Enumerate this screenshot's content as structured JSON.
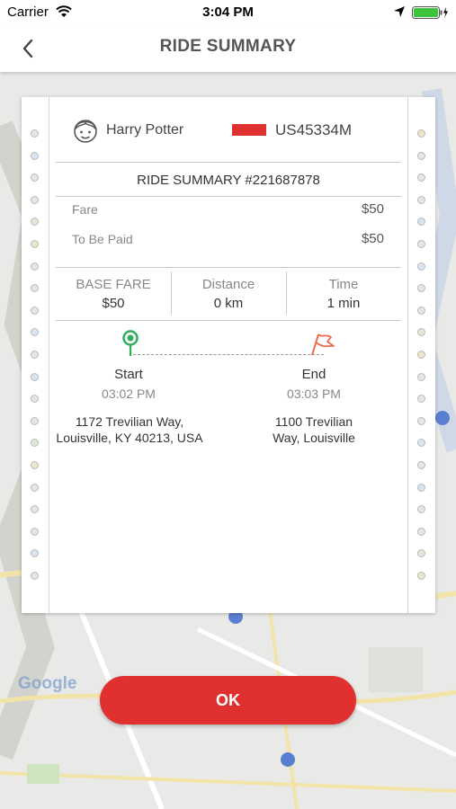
{
  "status_bar": {
    "carrier": "Carrier",
    "time": "3:04 PM"
  },
  "nav": {
    "title": "RIDE SUMMARY",
    "back_icon": "chevron-left-icon"
  },
  "map": {
    "logo": "Google"
  },
  "card": {
    "rider_name": "Harry Potter",
    "vehicle_plate": "US45334M",
    "summary_title": "RIDE SUMMARY #221687878",
    "rows": [
      {
        "label": "Fare",
        "value": "$50"
      },
      {
        "label": "To Be Paid",
        "value": "$50"
      }
    ],
    "stats": [
      {
        "label": "BASE FARE",
        "value": "$50"
      },
      {
        "label": "Distance",
        "value": "0 km"
      },
      {
        "label": "Time",
        "value": "1 min"
      }
    ],
    "start": {
      "label": "Start",
      "time": "03:02 PM",
      "address_line1": "1172 Trevilian Way,",
      "address_line2": "Louisville, KY 40213, USA"
    },
    "end": {
      "label": "End",
      "time": "03:03 PM",
      "address_line1": "1100 Trevilian",
      "address_line2": "Way, Louisville"
    }
  },
  "ok_button": {
    "label": "OK"
  },
  "colors": {
    "accent": "#e03030",
    "start_pin": "#2fae5a",
    "end_flag": "#ef6a4c"
  }
}
